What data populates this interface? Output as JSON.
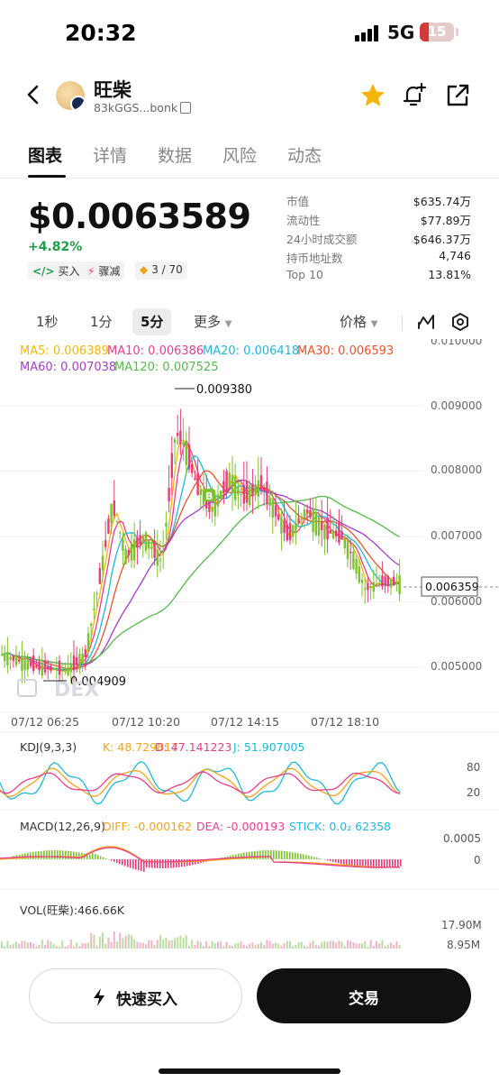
{
  "status_bar": {
    "time": "20:32",
    "network": "5G",
    "battery": "15"
  },
  "header": {
    "title": "旺柴",
    "address": "83kGGS...bonk",
    "icons": [
      "back-icon",
      "star-icon",
      "bell-add-icon",
      "share-icon"
    ]
  },
  "tabs": [
    {
      "label": "图表",
      "active": true
    },
    {
      "label": "详情",
      "active": false
    },
    {
      "label": "数据",
      "active": false
    },
    {
      "label": "风险",
      "active": false
    },
    {
      "label": "动态",
      "active": false
    }
  ],
  "price": {
    "value": "$0.0063589",
    "change": "+4.82%",
    "badges": {
      "buy": "买入",
      "dump": "骤减",
      "score": "3 / 70"
    }
  },
  "stats": [
    {
      "label": "市值",
      "value": "$635.74万"
    },
    {
      "label": "流动性",
      "value": "$77.89万"
    },
    {
      "label": "24小时成交额",
      "value": "$646.37万"
    },
    {
      "label": "持币地址数",
      "value": "4,746"
    },
    {
      "label": "Top 10",
      "value": "13.81%"
    }
  ],
  "toolbar": {
    "timeframes": [
      {
        "label": "1秒",
        "active": false
      },
      {
        "label": "1分",
        "active": false
      },
      {
        "label": "5分",
        "active": true
      },
      {
        "label": "更多",
        "active": false
      }
    ],
    "price_mode": "价格"
  },
  "chart_data": {
    "type": "candlestick",
    "ma_legend": [
      {
        "label": "MA5: 0.006389",
        "color": "#f0b90b"
      },
      {
        "label": "MA10: 0.006386",
        "color": "#e83e8c"
      },
      {
        "label": "MA20: 0.006418",
        "color": "#20b8d8"
      },
      {
        "label": "MA30: 0.006593",
        "color": "#e6562a"
      },
      {
        "label": "MA60: 0.007038",
        "color": "#a43fc8"
      },
      {
        "label": "MA120: 0.007525",
        "color": "#55b94c"
      }
    ],
    "y_ticks": [
      "0.009000",
      "0.008000",
      "0.007000",
      "0.006000",
      "0.005000"
    ],
    "y_tick_values": [
      0.009,
      0.008,
      0.007,
      0.006,
      0.005
    ],
    "y_top_partial": "0.010000",
    "x_ticks": [
      "07/12 06:25",
      "07/12 10:20",
      "07/12 14:15",
      "07/12 18:10"
    ],
    "high_label": "0.009380",
    "low_label": "0.004909",
    "current_label": "0.006359",
    "watermark": "DEX",
    "buy_marker": "B",
    "ylim": [
      0.0047,
      0.0102
    ]
  },
  "kdj": {
    "title": "KDJ(9,3,3)",
    "k": "K: 48.729817",
    "d": "D: 47.141223",
    "j": "J: 51.907005",
    "ticks": [
      "80",
      "20"
    ]
  },
  "macd": {
    "title": "MACD(12,26,9)",
    "diff": "DIFF: -0.000162",
    "dea": "DEA: -0.000193",
    "stick": "STICK: 0.0₂ 62358",
    "ticks": [
      "0.0005",
      "0"
    ]
  },
  "vol": {
    "title": "VOL(旺柴):466.66K",
    "ticks": [
      "17.90M",
      "8.95M"
    ]
  },
  "actions": {
    "quick_buy": "快速买入",
    "trade": "交易"
  }
}
